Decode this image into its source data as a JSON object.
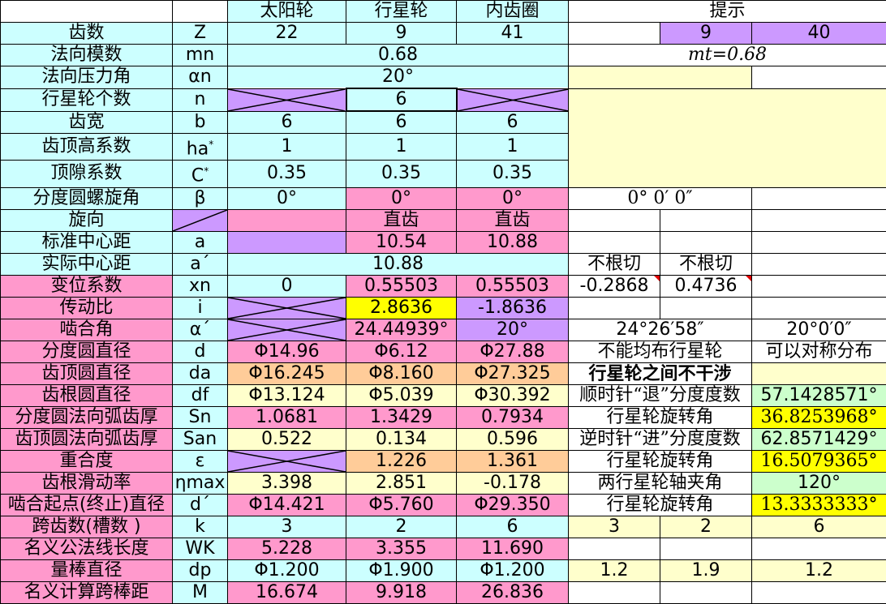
{
  "header": {
    "col_sun": "太阳轮",
    "col_planet": "行星轮",
    "col_ring": "内齿圈",
    "col_hint": "提示"
  },
  "rows": {
    "teeth": {
      "label": "齿数",
      "sym": "Z",
      "sun": "22",
      "planet": "9",
      "ring": "41",
      "h2": "9",
      "h3": "40"
    },
    "module": {
      "label": "法向模数",
      "sym": "mn",
      "val": "0.68",
      "hint": "mt=0.68"
    },
    "angle": {
      "label": "法向压力角",
      "sym": "αn",
      "val": "20°"
    },
    "count": {
      "label": "行星轮个数",
      "sym": "n",
      "planet": "6"
    },
    "width": {
      "label": "齿宽",
      "sym": "b",
      "sun": "6",
      "planet": "6",
      "ring": "6"
    },
    "addend": {
      "label": "齿顶高系数",
      "sym": "ha",
      "sup": "*",
      "sun": "1",
      "planet": "1",
      "ring": "1"
    },
    "clear": {
      "label": "顶隙系数",
      "sym": "C",
      "sup": "*",
      "sun": "0.35",
      "planet": "0.35",
      "ring": "0.35"
    },
    "helix": {
      "label": "分度圆螺旋角",
      "sym": "β",
      "sun": "0°",
      "planet": "0°",
      "ring": "0°",
      "hint": "0° 0′ 0″"
    },
    "hand": {
      "label": "旋向",
      "planet": "直齿",
      "ring": "直齿"
    },
    "stdcd": {
      "label": "标准中心距",
      "sym": "a",
      "planet": "10.54",
      "ring": "10.88"
    },
    "actcd": {
      "label": "实际中心距",
      "sym": "a´",
      "val": "10.88",
      "h1": "不根切",
      "h2": "不根切"
    },
    "shift": {
      "label": "变位系数",
      "sym": "xn",
      "sun": "0",
      "planet": "0.55503",
      "ring": "0.55503",
      "h1": "-0.2868",
      "h2": "0.4736"
    },
    "ratio": {
      "label": "传动比",
      "sym": "i",
      "planet": "2.8636",
      "ring": "-1.8636"
    },
    "mesh": {
      "label": "啮合角",
      "sym": "α´",
      "planet": "24.44939°",
      "ring": "20°",
      "h1": "24°26′58″",
      "h3": "20°0′0″"
    },
    "pitchd": {
      "label": "分度圆直径",
      "sym": "d",
      "sun": "Φ14.96",
      "planet": "Φ6.12",
      "ring": "Φ27.88",
      "h1": "不能均布行星轮",
      "h3": "可以对称分布"
    },
    "tipd": {
      "label": "齿顶圆直径",
      "sym": "da",
      "sun": "Φ16.245",
      "planet": "Φ8.160",
      "ring": "Φ27.325",
      "h1": "行星轮之间不干涉"
    },
    "rootd": {
      "label": "齿根圆直径",
      "sym": "df",
      "sun": "Φ13.124",
      "planet": "Φ5.039",
      "ring": "Φ30.392",
      "h1": "顺时针“退”分度度数",
      "h3": "57.1428571°"
    },
    "sn": {
      "label": "分度圆法向弧齿厚",
      "sym": "Sn",
      "sun": "1.0681",
      "planet": "1.3429",
      "ring": "0.7934",
      "h1": "行星轮旋转角",
      "h3": "36.8253968°"
    },
    "san": {
      "label": "齿顶圆法向弧齿厚",
      "sym": "San",
      "sun": "0.522",
      "planet": "0.134",
      "ring": "0.596",
      "h1": "逆时针“进”分度度数",
      "h3": "62.8571429°"
    },
    "overlap": {
      "label": "重合度",
      "sym": "ε",
      "planet": "1.226",
      "ring": "1.361",
      "h1": "行星轮旋转角",
      "h3": "16.5079365°"
    },
    "slide": {
      "label": "齿根滑动率",
      "sym": "ηmax",
      "sun": "3.398",
      "planet": "2.851",
      "ring": "-0.178",
      "h1": "两行星轮轴夹角",
      "h3": "120°"
    },
    "startd": {
      "label": "啮合起点(终止)直径",
      "sym": "d´",
      "sun": "Φ14.421",
      "planet": "Φ5.760",
      "ring": "Φ29.350",
      "h1": "行星轮旋转角",
      "h3": "13.3333333°"
    },
    "span": {
      "label": "跨齿数(槽数 )",
      "sym": "k",
      "sun": "3",
      "planet": "2",
      "ring": "6",
      "h1": "3",
      "h2": "2",
      "h3": "6"
    },
    "wk": {
      "label": "名义公法线长度",
      "sym": "WK",
      "sun": "5.228",
      "planet": "3.355",
      "ring": "11.690"
    },
    "dp": {
      "label": "量棒直径",
      "sym": "dp",
      "sun": "Φ1.200",
      "planet": "Φ1.900",
      "ring": "Φ1.200",
      "h1": "1.2",
      "h2": "1.9",
      "h3": "1.2"
    },
    "m": {
      "label": "名义计算跨棒距",
      "sym": "M",
      "sun": "16.674",
      "planet": "9.918",
      "ring": "26.836"
    }
  },
  "colors": {
    "cyan": "#ccffff",
    "pink": "#ff99cc",
    "purple": "#cc99ff",
    "light_yellow": "#ffffcc",
    "peach": "#ffcc99",
    "yellow": "#ffff00",
    "green": "#ccffcc",
    "blue_text": "#1c1cd8",
    "red_text": "#d01010"
  }
}
